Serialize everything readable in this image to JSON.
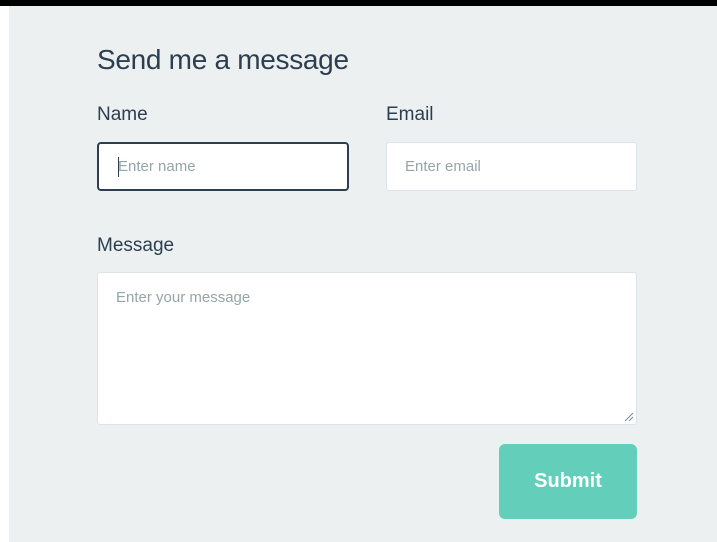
{
  "form": {
    "title": "Send me a message",
    "name_label": "Name",
    "name_placeholder": "Enter name",
    "name_value": "",
    "email_label": "Email",
    "email_placeholder": "Enter email",
    "email_value": "",
    "message_label": "Message",
    "message_placeholder": "Enter your message",
    "message_value": "",
    "submit_label": "Submit"
  },
  "colors": {
    "panel_background": "#ecf0f1",
    "text": "#2c3e50",
    "placeholder": "#95a5a6",
    "submit_button": "#63cfbb",
    "focus_border": "#2c3e50"
  },
  "icons": {
    "resize_grip": "textarea-resize-grip-icon"
  }
}
